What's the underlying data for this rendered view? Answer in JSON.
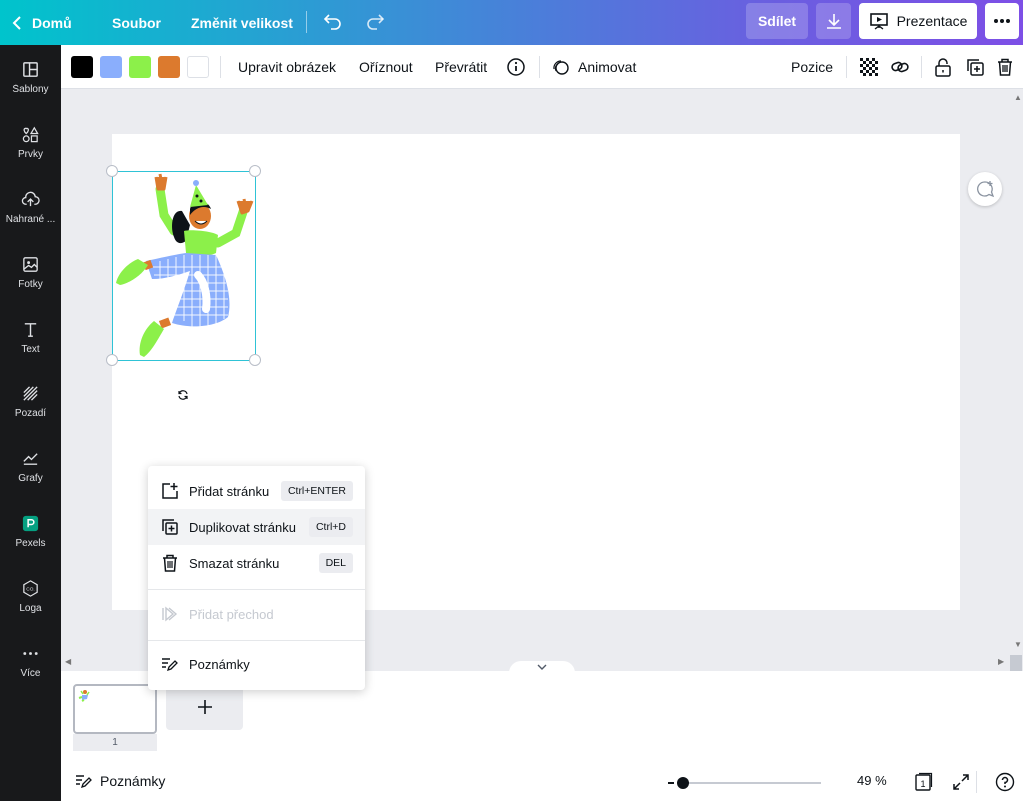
{
  "topbar": {
    "home": "Domů",
    "file": "Soubor",
    "resize": "Změnit velikost",
    "share": "Sdílet",
    "present": "Prezentace"
  },
  "sidebar": {
    "items": [
      {
        "label": "Šablony",
        "icon": "templates-icon"
      },
      {
        "label": "Prvky",
        "icon": "elements-icon"
      },
      {
        "label": "Nahrané ...",
        "icon": "upload-icon"
      },
      {
        "label": "Fotky",
        "icon": "photos-icon"
      },
      {
        "label": "Text",
        "icon": "text-icon"
      },
      {
        "label": "Pozadí",
        "icon": "background-icon"
      },
      {
        "label": "Grafy",
        "icon": "charts-icon"
      },
      {
        "label": "Pexels",
        "icon": "pexels-icon"
      },
      {
        "label": "Loga",
        "icon": "logos-icon"
      },
      {
        "label": "Více",
        "icon": "more-icon"
      }
    ]
  },
  "toolbar": {
    "colors": [
      "#000000",
      "#8aaefc",
      "#8cf04a",
      "#dc7a2e",
      "#ffffff"
    ],
    "edit_image": "Upravit obrázek",
    "crop": "Oříznout",
    "flip": "Převrátit",
    "animate": "Animovat",
    "position": "Pozice"
  },
  "context_menu": {
    "add_page": {
      "label": "Přidat stránku",
      "shortcut": "Ctrl+ENTER"
    },
    "duplicate_page": {
      "label": "Duplikovat stránku",
      "shortcut": "Ctrl+D"
    },
    "delete_page": {
      "label": "Smazat stránku",
      "shortcut": "DEL"
    },
    "add_transition": {
      "label": "Přidat přechod"
    },
    "notes": {
      "label": "Poznámky"
    }
  },
  "pagestrip": {
    "page_number": "1"
  },
  "footer": {
    "notes": "Poznámky",
    "zoom": "49 %",
    "zoom_level": 0.49,
    "page_count": "1"
  }
}
